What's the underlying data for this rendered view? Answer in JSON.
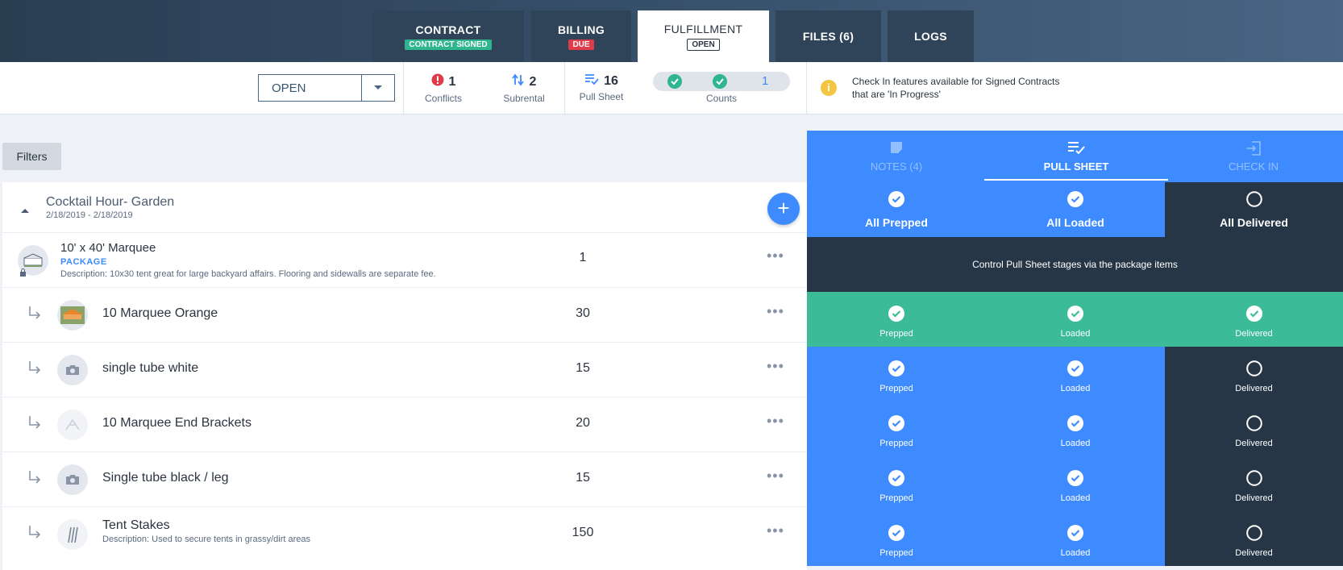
{
  "tabs": [
    {
      "label": "CONTRACT",
      "badge": "CONTRACT SIGNED"
    },
    {
      "label": "BILLING",
      "badge": "DUE"
    },
    {
      "label": "FULFILLMENT",
      "badge": "OPEN"
    },
    {
      "label": "FILES (6)"
    },
    {
      "label": "LOGS"
    }
  ],
  "status": {
    "select_value": "OPEN",
    "conflicts_count": "1",
    "conflicts_label": "Conflicts",
    "subrental_count": "2",
    "subrental_label": "Subrental",
    "pullsheet_count": "16",
    "pullsheet_label": "Pull Sheet",
    "counts_number": "1",
    "counts_label": "Counts",
    "info_line1": "Check In features available for Signed Contracts",
    "info_line2": "that are 'In Progress'"
  },
  "filters_label": "Filters",
  "group": {
    "title": "Cocktail Hour- Garden",
    "dates": "2/18/2019 - 2/18/2019"
  },
  "items": [
    {
      "name": "10' x 40' Marquee",
      "tag": "PACKAGE",
      "description": "Description: 10x30 tent great for large backyard affairs. Flooring and sidewalls are separate fee.",
      "qty": "1"
    },
    {
      "name": "10 Marquee Orange",
      "qty": "30"
    },
    {
      "name": "single tube white",
      "qty": "15"
    },
    {
      "name": "10 Marquee End Brackets",
      "qty": "20"
    },
    {
      "name": "Single tube black / leg",
      "qty": "15"
    },
    {
      "name": "Tent Stakes",
      "description": "Description: Used to secure tents in grassy/dirt areas",
      "qty": "150"
    }
  ],
  "panel": {
    "tabs": [
      "NOTES (4)",
      "PULL SHEET",
      "CHECK IN"
    ],
    "all_prepped": "All Prepped",
    "all_loaded": "All Loaded",
    "all_delivered": "All Delivered",
    "package_note": "Control Pull Sheet stages via the package items",
    "prepped": "Prepped",
    "loaded": "Loaded",
    "delivered": "Delivered"
  },
  "colors": {
    "accent_blue": "#3d8bff",
    "dark": "#263647",
    "green": "#3bbb97",
    "conflict_red": "#e03b4a"
  }
}
